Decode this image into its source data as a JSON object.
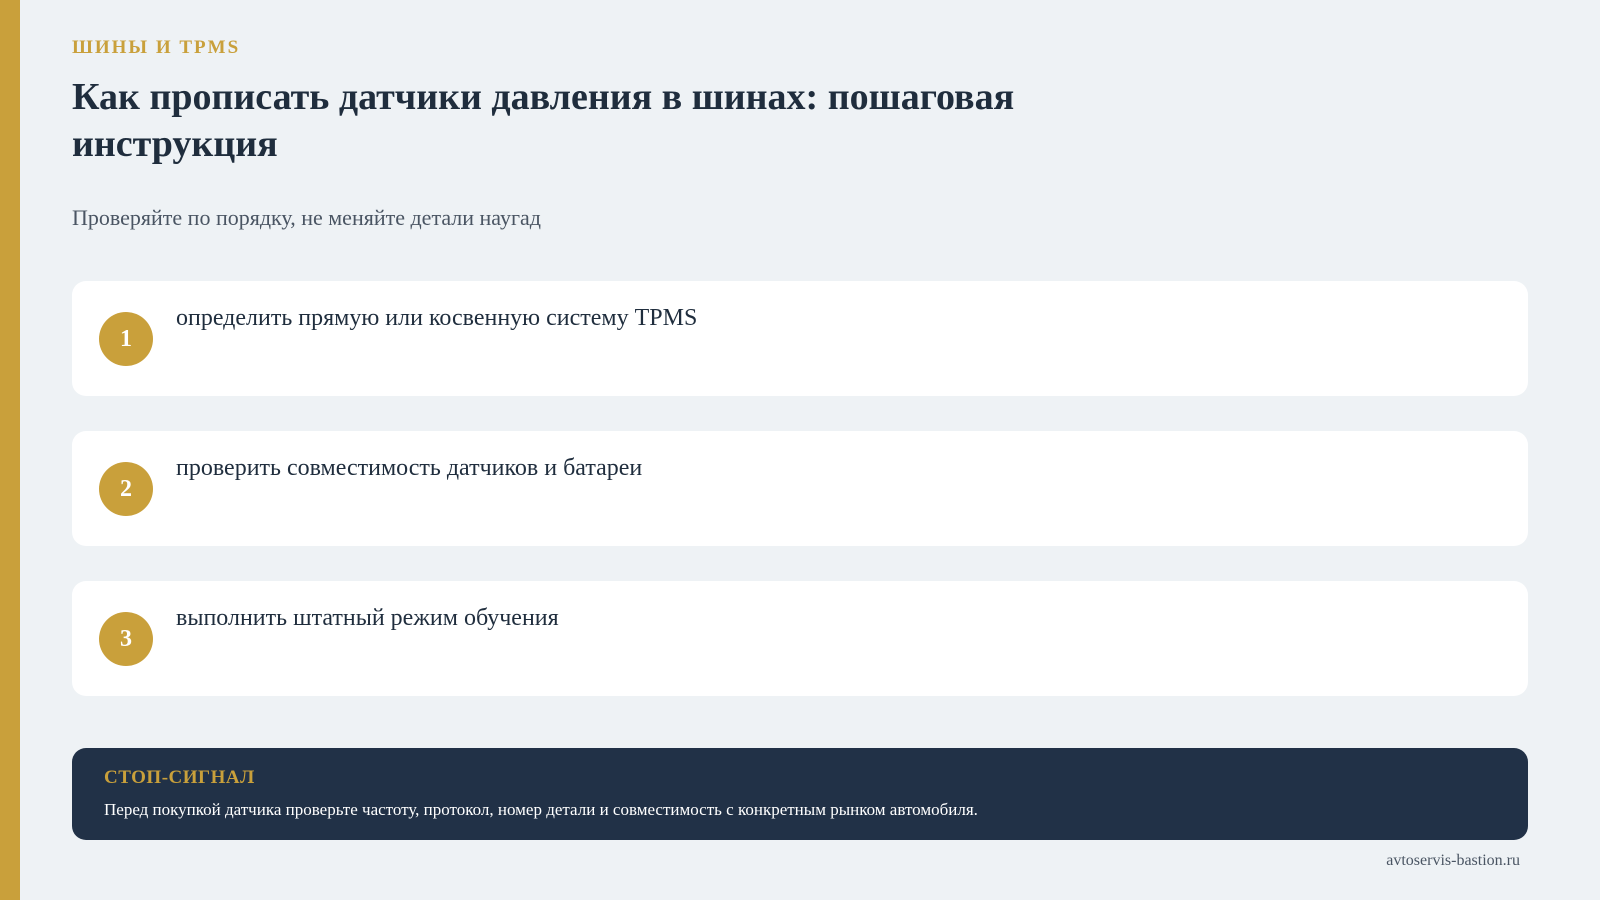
{
  "header": {
    "category": "ШИНЫ И TPMS",
    "title": "Как прописать датчики давления в шинах: пошаговая инструкция",
    "subtitle": "Проверяйте по порядку, не меняйте детали наугад"
  },
  "steps": [
    {
      "number": "1",
      "text": "определить прямую или косвенную систему TPMS"
    },
    {
      "number": "2",
      "text": "проверить совместимость датчиков и батареи"
    },
    {
      "number": "3",
      "text": "выполнить штатный режим обучения"
    }
  ],
  "stop_signal": {
    "label": "СТОП-СИГНАЛ",
    "text": "Перед покупкой датчика проверьте частоту, протокол, номер детали и совместимость с конкретным рынком автомобиля."
  },
  "footer": {
    "site": "avtoservis-bastion.ru"
  },
  "colors": {
    "accent": "#c9a03b",
    "background": "#eef2f5",
    "dark_panel": "#213147",
    "text": "#1f2d3d"
  }
}
